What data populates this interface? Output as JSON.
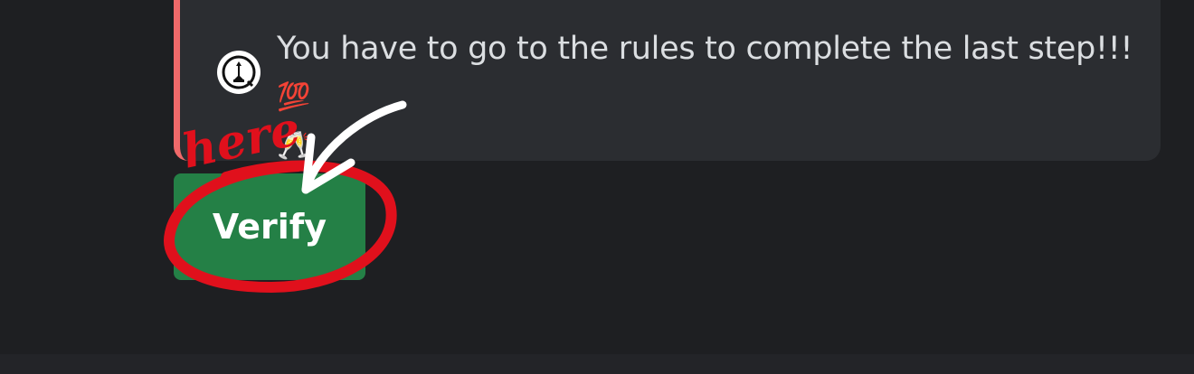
{
  "embed": {
    "message": "You have to go to the rules to complete the last step!!!",
    "emoji_100": "💯",
    "emoji_cheers": "🥂",
    "accent_color": "#f0696a",
    "avatar_icon": "chess-piece-icon"
  },
  "button": {
    "label": "Verify",
    "color": "#248046"
  },
  "annotation": {
    "handwritten_text": "here",
    "ink_color": "#e0101c",
    "arrow_color": "#ffffff"
  }
}
